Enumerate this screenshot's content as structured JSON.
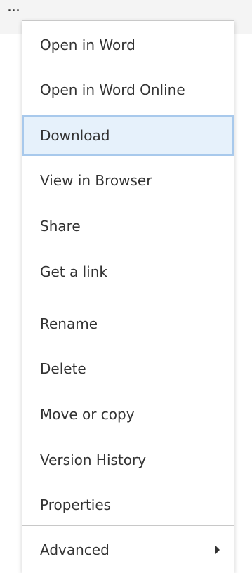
{
  "toolbar": {
    "more_icon": "ellipsis-icon",
    "more_glyph": "..."
  },
  "menu": {
    "items": [
      {
        "label": "Open in Word"
      },
      {
        "label": "Open in Word Online"
      },
      {
        "label": "Download",
        "highlighted": true
      },
      {
        "label": "View in Browser"
      },
      {
        "label": "Share"
      },
      {
        "label": "Get a link"
      },
      {
        "label": "Rename"
      },
      {
        "label": "Delete"
      },
      {
        "label": "Move or copy"
      },
      {
        "label": "Version History"
      },
      {
        "label": "Properties"
      },
      {
        "label": "Advanced",
        "submenu": true
      }
    ],
    "submenu_icon": "chevron-right-icon"
  },
  "colors": {
    "highlight_bg": "#e6f1fb",
    "highlight_border": "#a8c9ec",
    "text": "#333333"
  }
}
